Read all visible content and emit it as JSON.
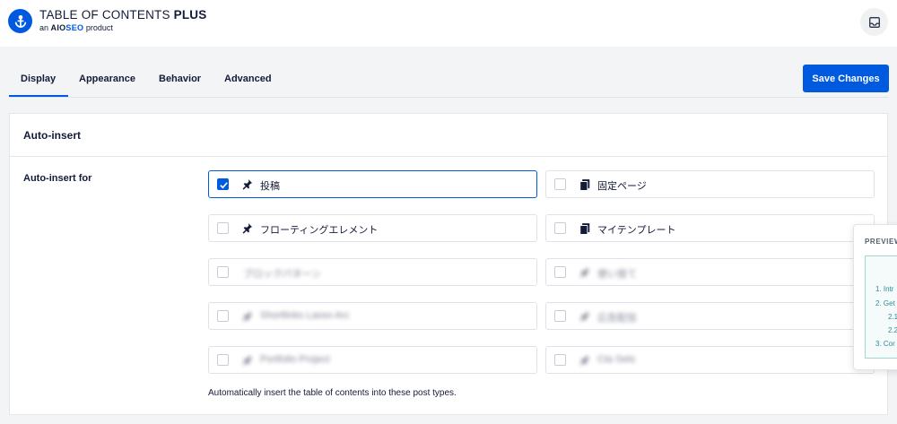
{
  "brand": {
    "title_main": "TABLE OF CONTENTS ",
    "title_bold": "PLUS",
    "sub_prefix": "an ",
    "sub_aio": "AIO",
    "sub_seo": "SEO",
    "sub_suffix": " product"
  },
  "tabs": [
    {
      "label": "Display",
      "active": true
    },
    {
      "label": "Appearance",
      "active": false
    },
    {
      "label": "Behavior",
      "active": false
    },
    {
      "label": "Advanced",
      "active": false
    }
  ],
  "save_button": "Save Changes",
  "panel": {
    "title": "Auto-insert",
    "row_label": "Auto-insert for",
    "help_text": "Automatically insert the table of contents into these post types."
  },
  "options": [
    {
      "label": "投稿",
      "checked": true,
      "icon": "pin-icon"
    },
    {
      "label": "固定ページ",
      "checked": false,
      "icon": "pages-icon"
    },
    {
      "label": "フローティングエレメント",
      "checked": false,
      "icon": "pin-icon"
    },
    {
      "label": "マイテンプレート",
      "checked": false,
      "icon": "pages-icon"
    },
    {
      "label": "ブロックパターン",
      "checked": false,
      "icon": "none",
      "blurred": true
    },
    {
      "label": "使い捨て",
      "checked": false,
      "icon": "pin-icon",
      "blurred": true
    },
    {
      "label": "Shortlinks Lasso Arc",
      "checked": false,
      "icon": "pin-icon",
      "blurred": true
    },
    {
      "label": "広告配信",
      "checked": false,
      "icon": "pin-icon",
      "blurred": true
    },
    {
      "label": "Portfolio Project",
      "checked": false,
      "icon": "pin-icon",
      "blurred": true
    },
    {
      "label": "Cta Sets",
      "checked": false,
      "icon": "pin-icon",
      "blurred": true
    }
  ],
  "preview": {
    "title": "PREVIEW",
    "items": [
      "1. Intr",
      "2. Get",
      "2.1",
      "2.2",
      "3. Cor"
    ]
  },
  "colors": {
    "accent": "#005ae0",
    "text": "#141b38",
    "toc_link": "#2f8a9e"
  }
}
